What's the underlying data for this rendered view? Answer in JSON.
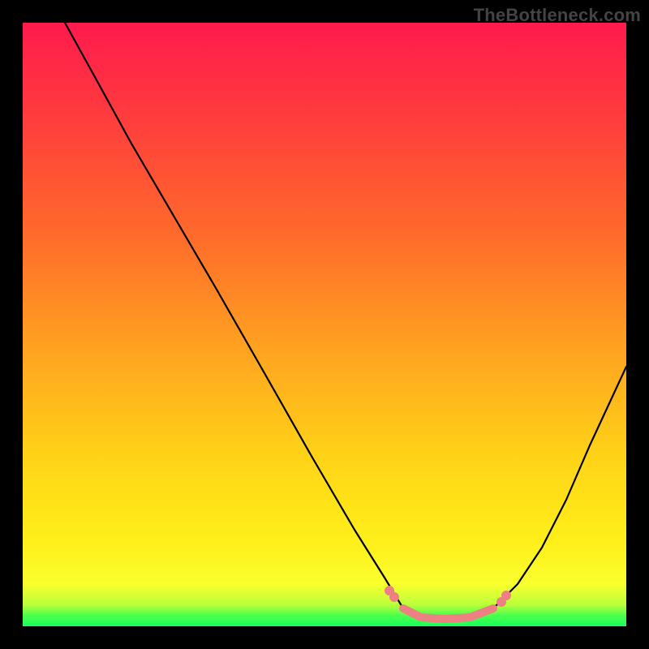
{
  "watermark": "TheBottleneck.com",
  "colors": {
    "curve_black": "#000000",
    "curve_pink": "#ec8082",
    "gradient_top": "#ff1a4d",
    "gradient_mid": "#ffd317",
    "gradient_bottom": "#18ff5a",
    "frame": "#000000"
  },
  "chart_data": {
    "type": "line",
    "title": "",
    "xlabel": "",
    "ylabel": "",
    "xlim": [
      0,
      100
    ],
    "ylim": [
      0,
      100
    ],
    "grid": false,
    "legend_position": "none",
    "series": [
      {
        "name": "bottleneck-curve",
        "x": [
          7,
          12,
          18,
          25,
          32,
          40,
          48,
          55,
          60,
          63,
          66,
          70,
          74,
          78,
          82,
          86,
          90,
          94,
          100
        ],
        "y": [
          100,
          91,
          80,
          68,
          56,
          42,
          28,
          16,
          8,
          3,
          1.5,
          1.2,
          1.5,
          3,
          7,
          13,
          21,
          30,
          43
        ]
      },
      {
        "name": "optimal-zone",
        "x": [
          60,
          63,
          66,
          70,
          74,
          78
        ],
        "y": [
          8,
          3,
          1.5,
          1.2,
          1.5,
          3
        ]
      }
    ],
    "annotations": [
      {
        "text": "TheBottleneck.com",
        "x": 100,
        "y": 100,
        "anchor": "top-right"
      }
    ]
  }
}
